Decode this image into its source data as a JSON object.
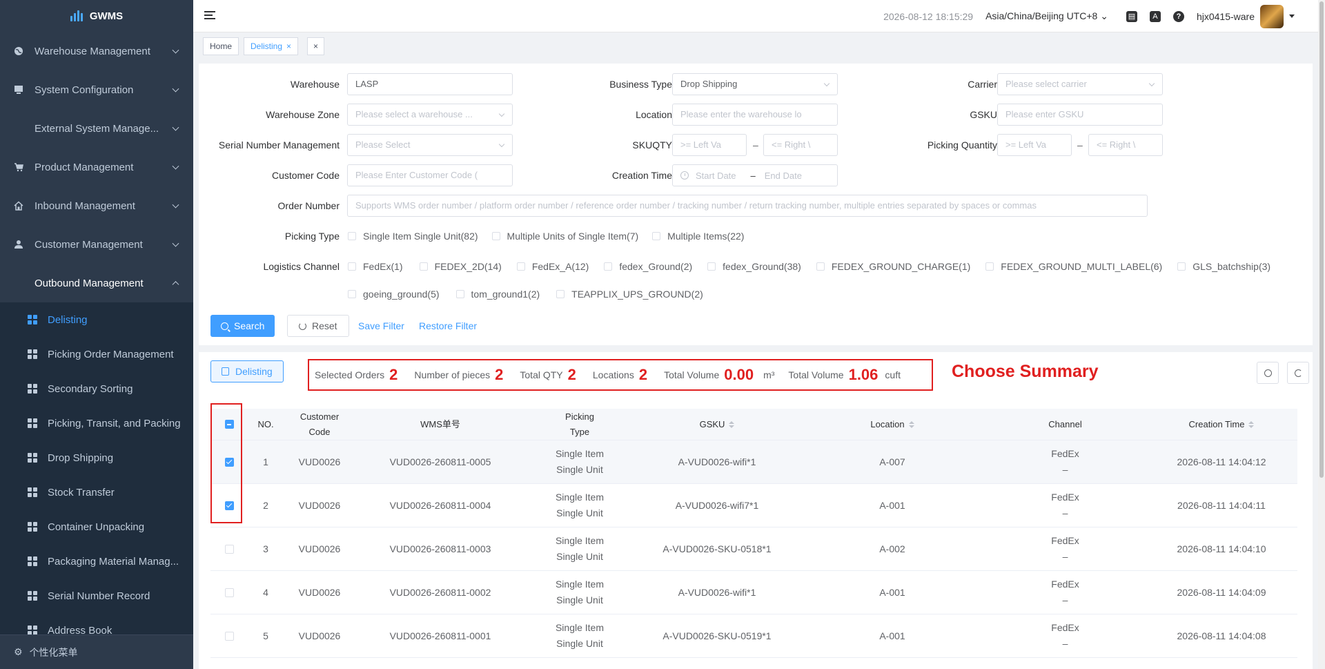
{
  "app": {
    "logo_text": "GWMS"
  },
  "sidebar": {
    "menus": [
      {
        "label": "Warehouse Management",
        "icon": "globe-icon"
      },
      {
        "label": "System Configuration",
        "icon": "monitor-icon"
      },
      {
        "label": "External System Manage...",
        "icon": "apps-icon"
      },
      {
        "label": "Product Management",
        "icon": "cart-icon"
      },
      {
        "label": "Inbound Management",
        "icon": "home-icon"
      },
      {
        "label": "Customer Management",
        "icon": "user-icon"
      },
      {
        "label": "Outbound Management",
        "icon": "apps-icon"
      }
    ],
    "submenu": [
      "Delisting",
      "Picking Order Management",
      "Secondary Sorting",
      "Picking, Transit, and Packing",
      "Drop Shipping",
      "Stock Transfer",
      "Container Unpacking",
      "Packaging Material Manag...",
      "Serial Number Record",
      "Address Book"
    ],
    "footer_label": "个性化菜单"
  },
  "header": {
    "datetime": "2026-08-12 18:15:29",
    "timezone": "Asia/China/Beijing UTC+8",
    "username": "hjx0415-ware"
  },
  "tabs": [
    {
      "label": "Home"
    },
    {
      "label": "Delisting"
    }
  ],
  "filters": {
    "warehouse_label": "Warehouse",
    "warehouse_value": "LASP",
    "business_type_label": "Business Type",
    "business_type_value": "Drop Shipping",
    "carrier_label": "Carrier",
    "carrier_placeholder": "Please select carrier",
    "zone_label": "Warehouse Zone",
    "zone_placeholder": "Please select a warehouse ...",
    "location_label": "Location",
    "location_placeholder": "Please enter the warehouse lo",
    "gsku_label": "GSKU",
    "gsku_placeholder": "Please enter GSKU",
    "serial_label": "Serial Number Management",
    "serial_placeholder": "Please Select",
    "skuqty_label": "SKUQTY",
    "left_placeholder": ">= Left Va",
    "right_placeholder": "<= Right \\",
    "picking_qty_label": "Picking Quantity",
    "customer_label": "Customer Code",
    "customer_placeholder": "Please Enter Customer Code (",
    "creation_label": "Creation Time",
    "start_date": "Start Date",
    "end_date": "End Date",
    "range_sep": "–",
    "order_label": "Order Number",
    "order_placeholder": "Supports WMS order number / platform order number / reference order number / tracking number / return tracking number, multiple entries separated by spaces or commas",
    "picking_type_label": "Picking Type",
    "picking_types": [
      "Single Item Single Unit(82)",
      "Multiple Units of Single Item(7)",
      "Multiple Items(22)"
    ],
    "logistics_label": "Logistics Channel",
    "channels_row1": [
      "FedEx(1)",
      "FEDEX_2D(14)",
      "FedEx_A(12)",
      "fedex_Ground(2)",
      "fedex_Ground(38)",
      "FEDEX_GROUND_CHARGE(1)",
      "FEDEX_GROUND_MULTI_LABEL(6)",
      "GLS_batchship(3)"
    ],
    "channels_row2": [
      "goeing_ground(5)",
      "tom_ground1(2)",
      "TEAPPLIX_UPS_GROUND(2)"
    ]
  },
  "actions": {
    "search": "Search",
    "reset": "Reset",
    "save_filter": "Save Filter",
    "restore_filter": "Restore Filter",
    "delisting": "Delisting"
  },
  "summary": {
    "selected_orders_label": "Selected Orders",
    "selected_orders": "2",
    "pieces_label": "Number of pieces",
    "pieces": "2",
    "total_qty_label": "Total QTY",
    "total_qty": "2",
    "locations_label": "Locations",
    "locations": "2",
    "volume_label": "Total Volume",
    "volume_m3": "0.00",
    "unit_m3": "m³",
    "volume_cuft": "1.06",
    "unit_cuft": "cuft",
    "annotation": "Choose Summary"
  },
  "table": {
    "headers": {
      "no": "NO.",
      "customer": "Customer Code",
      "wms": "WMS单号",
      "picking": "Picking Type",
      "gsku": "GSKU",
      "location": "Location",
      "channel": "Channel",
      "time": "Creation Time"
    },
    "rows": [
      {
        "no": "1",
        "customer": "VUD0026",
        "wms": "VUD0026-260811-0005",
        "pick1": "Single Item",
        "pick2": "Single Unit",
        "gsku": "A-VUD0026-wifi*1",
        "location": "A-007",
        "chan1": "FedEx",
        "chan2": "–",
        "time": "2026-08-11 14:04:12",
        "checked": true
      },
      {
        "no": "2",
        "customer": "VUD0026",
        "wms": "VUD0026-260811-0004",
        "pick1": "Single Item",
        "pick2": "Single Unit",
        "gsku": "A-VUD0026-wifi7*1",
        "location": "A-001",
        "chan1": "FedEx",
        "chan2": "–",
        "time": "2026-08-11 14:04:11",
        "checked": true
      },
      {
        "no": "3",
        "customer": "VUD0026",
        "wms": "VUD0026-260811-0003",
        "pick1": "Single Item",
        "pick2": "Single Unit",
        "gsku": "A-VUD0026-SKU-0518*1",
        "location": "A-002",
        "chan1": "FedEx",
        "chan2": "–",
        "time": "2026-08-11 14:04:10",
        "checked": false
      },
      {
        "no": "4",
        "customer": "VUD0026",
        "wms": "VUD0026-260811-0002",
        "pick1": "Single Item",
        "pick2": "Single Unit",
        "gsku": "A-VUD0026-wifi*1",
        "location": "A-001",
        "chan1": "FedEx",
        "chan2": "–",
        "time": "2026-08-11 14:04:09",
        "checked": false
      },
      {
        "no": "5",
        "customer": "VUD0026",
        "wms": "VUD0026-260811-0001",
        "pick1": "Single Item",
        "pick2": "Single Unit",
        "gsku": "A-VUD0026-SKU-0519*1",
        "location": "A-001",
        "chan1": "FedEx",
        "chan2": "–",
        "time": "2026-08-11 14:04:08",
        "checked": false
      }
    ]
  }
}
